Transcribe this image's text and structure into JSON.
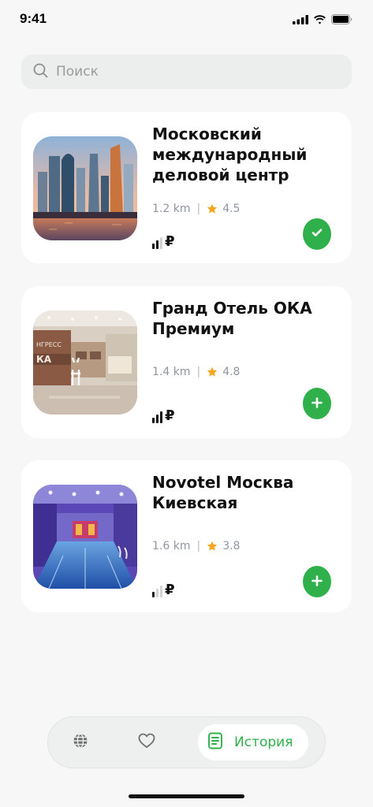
{
  "status_bar": {
    "time": "9:41"
  },
  "search": {
    "placeholder": "Поиск"
  },
  "hotels": [
    {
      "title": "Московский международный деловой центр",
      "distance": "1.2 km",
      "rating": "4.5",
      "price_level": 2,
      "price_symbol": "₽",
      "added": true
    },
    {
      "title": "Гранд Отель ОКА Премиум",
      "distance": "1.4 km",
      "rating": "4.8",
      "price_level": 3,
      "price_symbol": "₽",
      "added": false
    },
    {
      "title": "Novotel Москва Киевская",
      "distance": "1.6 km",
      "rating": "3.8",
      "price_level": 1,
      "price_symbol": "₽",
      "added": false
    }
  ],
  "tab_bar": {
    "items": [
      {
        "icon": "globe-icon",
        "label": ""
      },
      {
        "icon": "heart-icon",
        "label": ""
      },
      {
        "icon": "book-icon",
        "label": "История",
        "active": true
      }
    ]
  },
  "colors": {
    "accent": "#2fb04a",
    "star": "#f5a623",
    "card": "#ffffff",
    "background": "#f7f7f7"
  }
}
